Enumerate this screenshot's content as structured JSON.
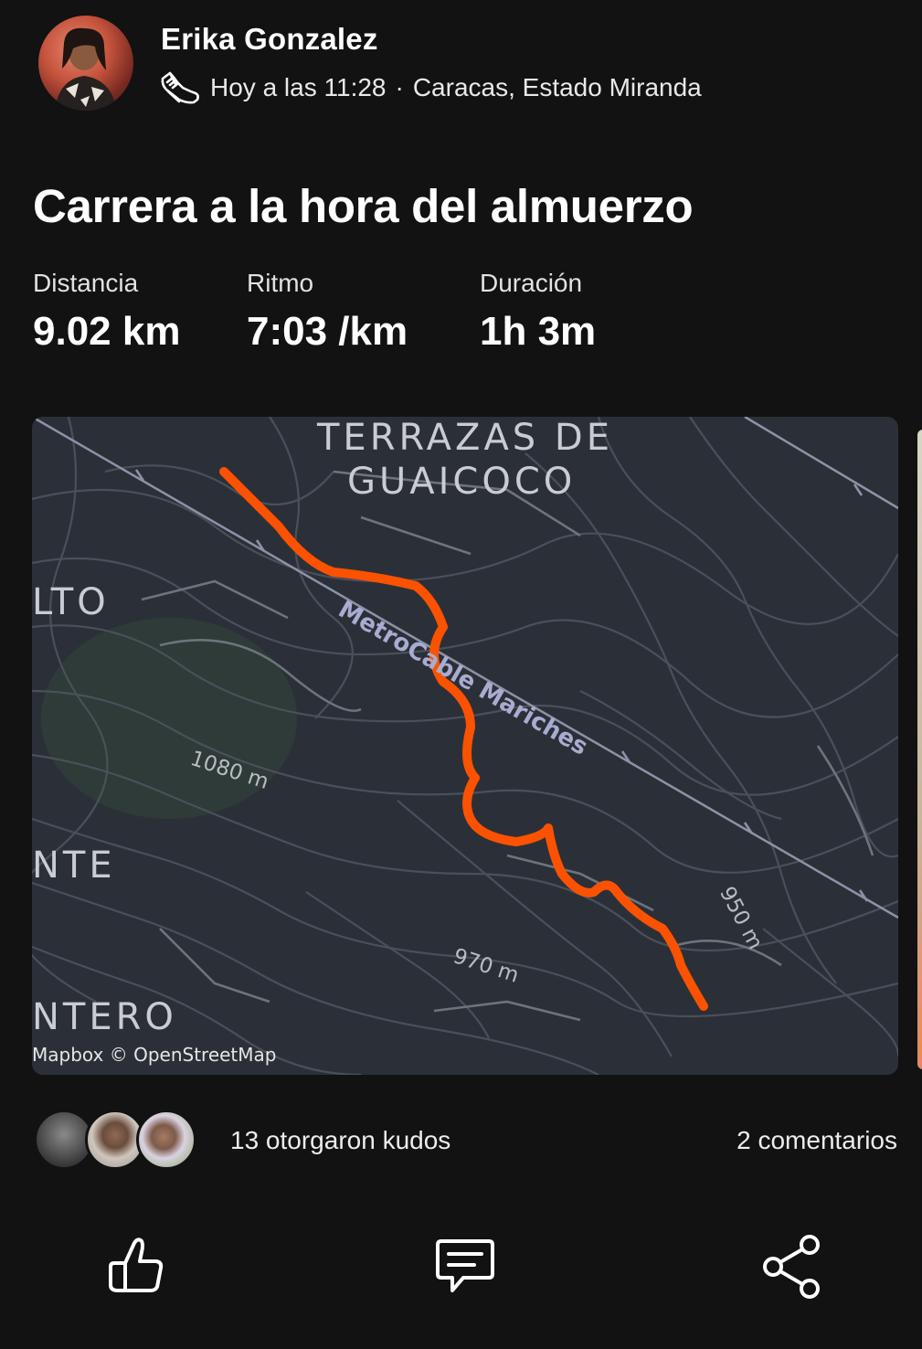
{
  "post": {
    "athlete_name": "Erika Gonzalez",
    "timestamp": "Hoy a las 11:28",
    "separator": "·",
    "location": "Caracas, Estado Miranda",
    "activity_icon": "shoe-icon",
    "title": "Carrera a la hora del almuerzo"
  },
  "stats": [
    {
      "label": "Distancia",
      "value": "9.02 km"
    },
    {
      "label": "Ritmo",
      "value": "7:03 /km"
    },
    {
      "label": "Duración",
      "value": "1h 3m"
    }
  ],
  "map": {
    "labels": {
      "terrazas_line1": "TERRAZAS DE",
      "terrazas_line2": "GUAICOCO",
      "alto": "LTO",
      "ente": "NTE",
      "ntero": "NTERO",
      "metrocable": "MetroCable Mariches",
      "elev_1080": "1080 m",
      "elev_970": "970 m",
      "elev_950": "950 m"
    },
    "attribution": "Mapbox © OpenStreetMap",
    "route_color": "#fc5200",
    "background_color": "#2b3038"
  },
  "social": {
    "kudos_text": "13 otorgaron kudos",
    "comments_text": "2 comentarios"
  },
  "actions": {
    "kudos_icon": "thumbs-up-icon",
    "comment_icon": "comment-icon",
    "share_icon": "share-icon"
  }
}
